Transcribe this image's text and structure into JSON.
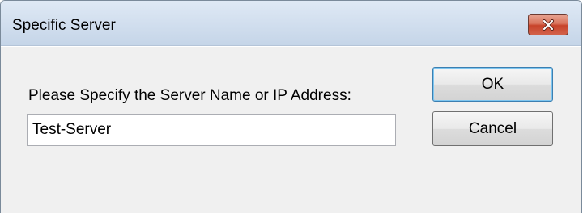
{
  "window": {
    "title": "Specific Server"
  },
  "dialog": {
    "prompt": "Please Specify the Server Name or IP Address:",
    "server_value": "Test-Server",
    "ok_label": "OK",
    "cancel_label": "Cancel"
  },
  "icons": {
    "close": "close-icon"
  },
  "colors": {
    "close_button": "#c7432a",
    "titlebar": "#c5d5e8",
    "client": "#f0f0f0"
  }
}
